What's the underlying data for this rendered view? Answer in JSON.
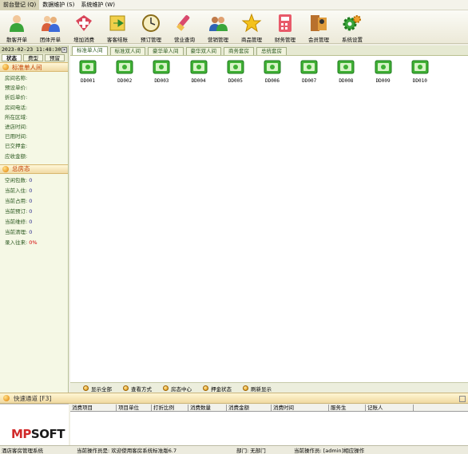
{
  "menu": [
    "前台登记 (Q)",
    "数据维护 (S)",
    "系统维护 (W)"
  ],
  "toolbar": [
    {
      "label": "散客开单",
      "icon": "person-green-icon"
    },
    {
      "label": "团体开单",
      "icon": "group-icon"
    },
    {
      "label": "增加消费",
      "icon": "add-consume-icon"
    },
    {
      "label": "客客结账",
      "icon": "checkout-icon"
    },
    {
      "label": "预订管理",
      "icon": "clock-icon"
    },
    {
      "label": "营业查询",
      "icon": "search-tool-icon"
    },
    {
      "label": "营销管理",
      "icon": "people-icon"
    },
    {
      "label": "商品管理",
      "icon": "star-icon"
    },
    {
      "label": "财务管理",
      "icon": "calculator-icon"
    },
    {
      "label": "会员管理",
      "icon": "member-icon"
    },
    {
      "label": "系统设置",
      "icon": "gear-icon"
    }
  ],
  "left": {
    "datetime": "2023-02-23 11:48:30",
    "tabs": [
      "状态",
      "费型",
      "预留"
    ],
    "room_section_title": "标准单人间",
    "room_fields": [
      "房间名称:",
      "预设单价:",
      "折后单价:",
      "房间电话:",
      "所在区域:",
      "进店时间:",
      "已用时间:",
      "已交押金:",
      "应收金额:"
    ],
    "status_section_title": "总房态",
    "stats": [
      {
        "label": "空闲包数:",
        "value": "0",
        "red": false
      },
      {
        "label": "当前入住:",
        "value": "0",
        "red": false
      },
      {
        "label": "当前占用:",
        "value": "0",
        "red": false
      },
      {
        "label": "当前预订:",
        "value": "0",
        "red": false
      },
      {
        "label": "当前维修:",
        "value": "0",
        "red": false
      },
      {
        "label": "当前清理:",
        "value": "0",
        "red": false
      },
      {
        "label": "录入往来:",
        "value": "0%",
        "red": true
      }
    ],
    "quick_title": "快速通道 [F3]",
    "logo_a": "MP",
    "logo_b": "SOFT"
  },
  "room_tabs": [
    "标准单人间",
    "标准双人间",
    "豪华单人间",
    "豪华双人间",
    "商务套房",
    "总统套房"
  ],
  "rooms": [
    "DD001",
    "DD002",
    "DD003",
    "DD004",
    "DD005",
    "DD006",
    "DD007",
    "DD008",
    "DD009",
    "DD010"
  ],
  "bottom_actions": [
    "显示全部",
    "查看方式",
    "房态中心",
    "押金状态",
    "刷新显示"
  ],
  "grid_headers": [
    "消费项目",
    "项目单位",
    "打折比例",
    "消费数量",
    "消费金额",
    "消费时间",
    "服务生",
    "记账人"
  ],
  "status": [
    "酒店客房管理系统",
    "当前操作员是: 欢迎使用客房系统标准版6.7",
    "部门: 无部门",
    "当前操作员: [admin]相应操作"
  ],
  "colors": {
    "room_green": "#3fb034",
    "section_title": "#c23d00"
  }
}
